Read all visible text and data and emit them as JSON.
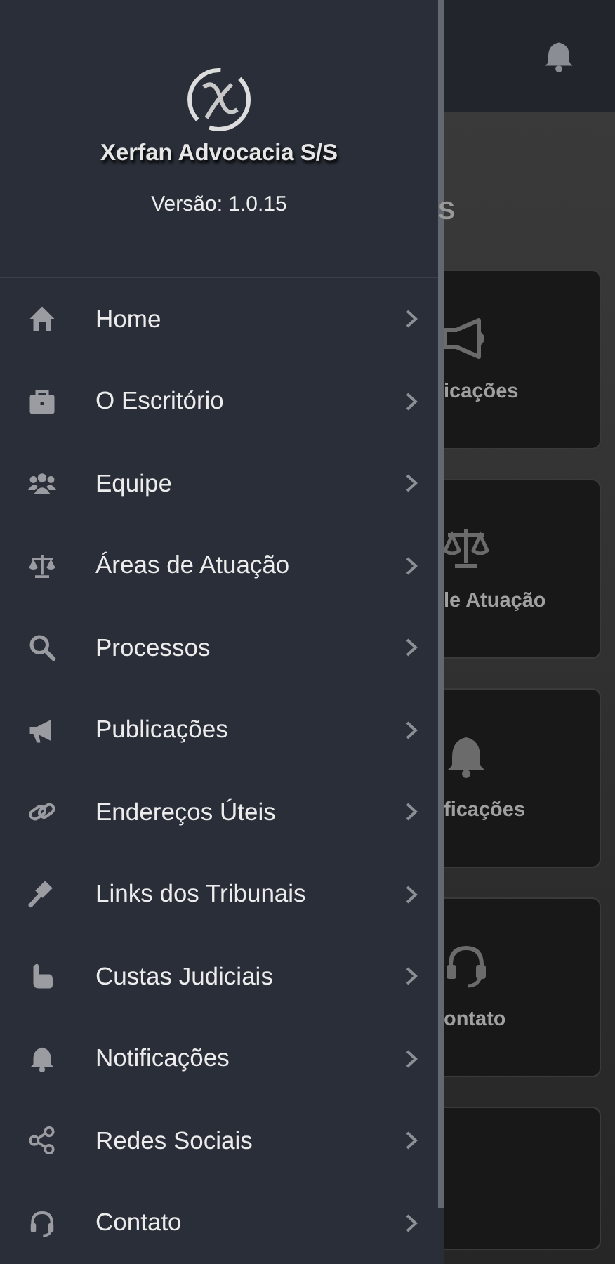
{
  "drawer": {
    "title": "Xerfan Advocacia S/S",
    "version": "Versão: 1.0.15",
    "items": [
      {
        "label": "Home"
      },
      {
        "label": "O Escritório"
      },
      {
        "label": "Equipe"
      },
      {
        "label": "Áreas de Atuação"
      },
      {
        "label": "Processos"
      },
      {
        "label": "Publicações"
      },
      {
        "label": "Endereços Úteis"
      },
      {
        "label": "Links dos Tribunais"
      },
      {
        "label": "Custas Judiciais"
      },
      {
        "label": "Notificações"
      },
      {
        "label": "Redes Sociais"
      },
      {
        "label": "Contato"
      }
    ]
  },
  "background": {
    "section_title": "S",
    "cards": [
      {
        "label": "icações"
      },
      {
        "label": "le Atuação"
      },
      {
        "label": "ficações"
      },
      {
        "label": "ontato"
      }
    ]
  }
}
